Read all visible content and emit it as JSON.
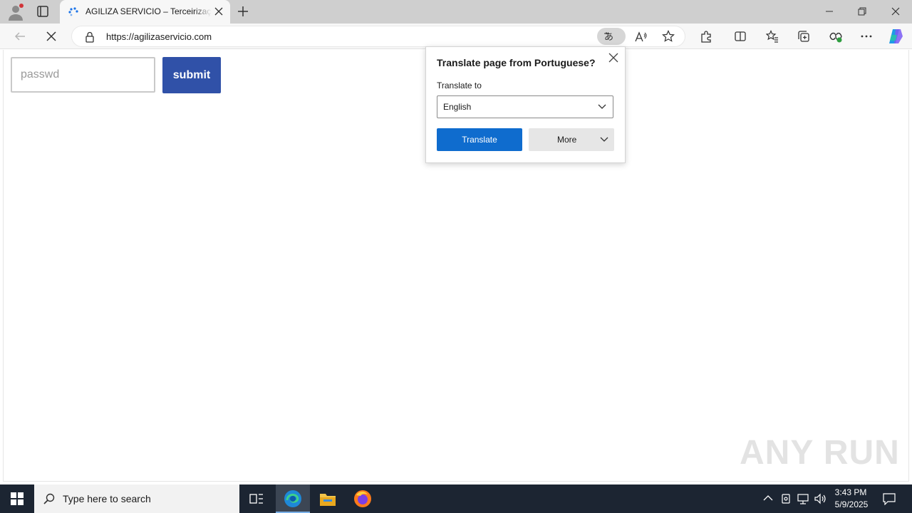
{
  "browser": {
    "tab": {
      "title": "AGILIZA SERVICIO – Terceirização de",
      "close_icon": "close-icon"
    },
    "address_bar": {
      "url": "https://agilizaservicio.com"
    }
  },
  "page": {
    "password_input": {
      "placeholder": "passwd",
      "value": ""
    },
    "submit_label": "submit"
  },
  "translate_popup": {
    "title": "Translate page from Portuguese?",
    "translate_to_label": "Translate to",
    "selected_language": "English",
    "translate_button": "Translate",
    "more_button": "More"
  },
  "watermark": "ANY RUN",
  "taskbar": {
    "search_placeholder": "Type here to search",
    "time": "3:43 PM",
    "date": "5/9/2025"
  },
  "colors": {
    "submit_button": "#3051a8",
    "translate_button": "#0f6cce",
    "taskbar": "#1c2532"
  }
}
